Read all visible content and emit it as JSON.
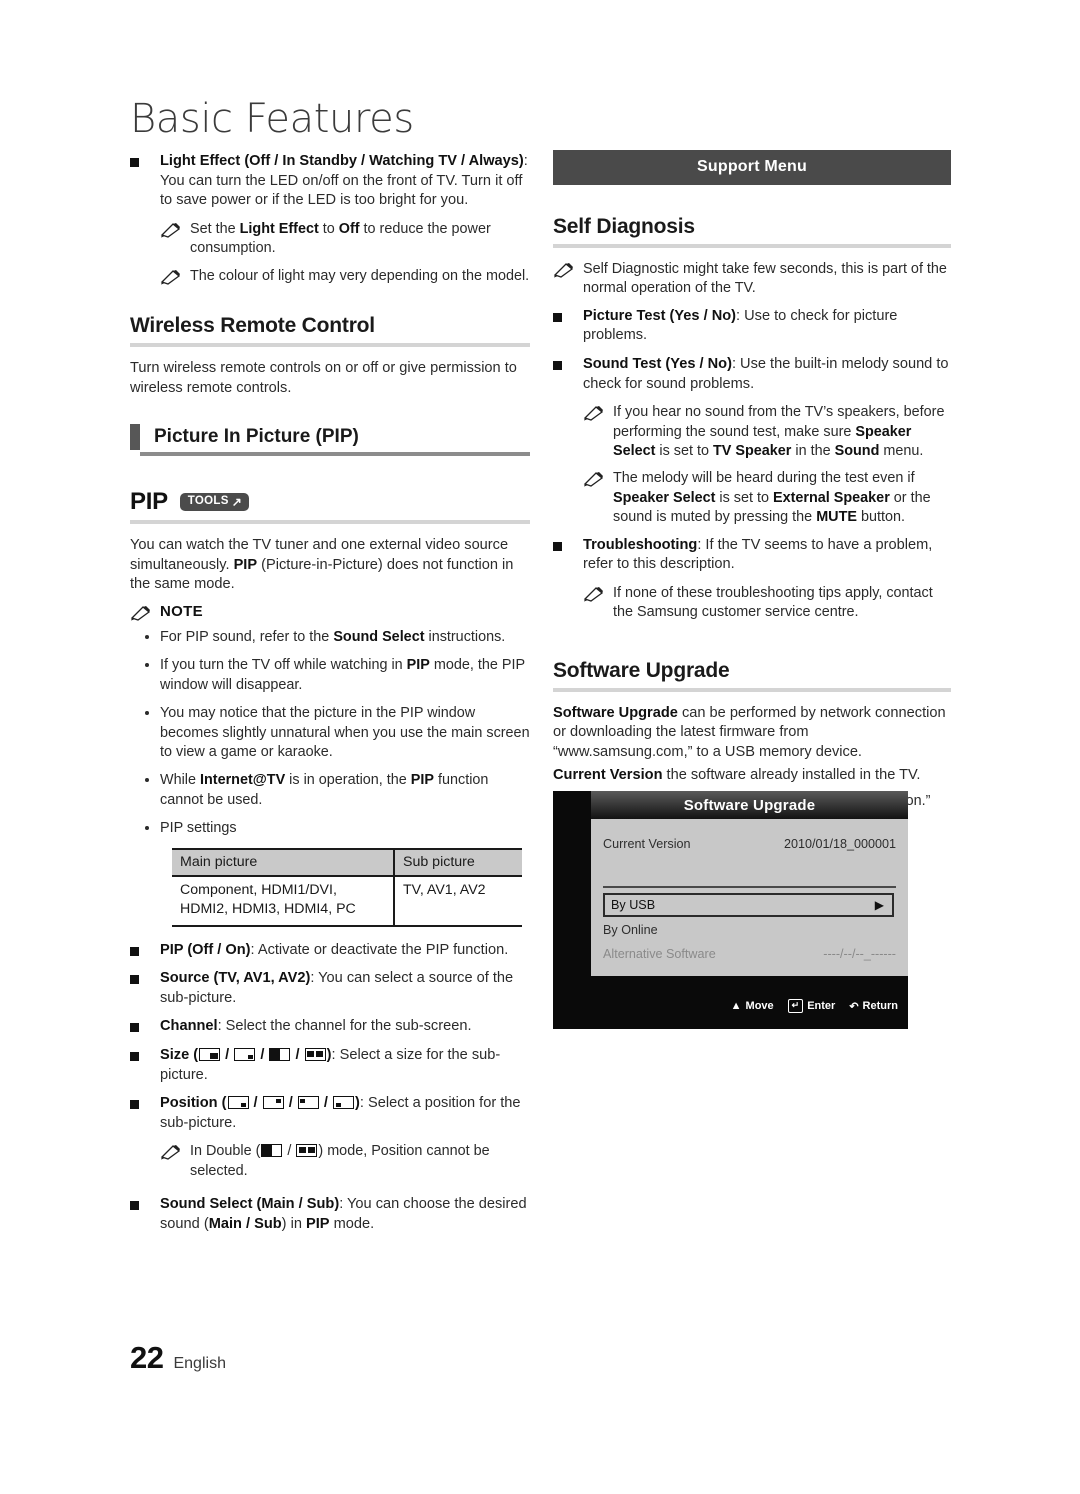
{
  "page": {
    "chapter_title": "Basic Features",
    "page_number": "22",
    "language": "English"
  },
  "left_column": {
    "light_effect": {
      "bullet": {
        "bold": "Light Effect (Off / In Standby / Watching TV / Always)",
        "rest": ": You can turn the LED on/off on the front of TV. Turn it off to save power or if the LED is too bright for you."
      },
      "notes": [
        "Set the Light Effect to Off to reduce the power consumption.",
        "The colour of light may very depending on the model."
      ]
    },
    "wireless_remote_control": {
      "heading": "Wireless Remote Control",
      "body": "Turn wireless remote controls on or off or give permission to wireless remote controls."
    },
    "pip_section": {
      "subheading": "Picture In Picture (PIP)",
      "pip_word": "PIP",
      "tools_badge": "TOOLS",
      "body": "You can watch the TV tuner and one external video source simultaneously. PIP (Picture-in-Picture) does not function in the same mode.",
      "note_label": "NOTE",
      "notes": [
        "For PIP sound, refer to the Sound Select instructions.",
        "If you turn the TV off while watching in PIP mode, the PIP window will disappear.",
        "You may notice that the picture in the PIP window becomes slightly unnatural when you use the main screen to view a game or karaoke.",
        "While Internet@TV is in operation, the PIP function cannot be used.",
        "PIP settings"
      ],
      "table": {
        "headers": [
          "Main picture",
          "Sub picture"
        ],
        "rows": [
          [
            "Component, HDMI1/DVI, HDMI2, HDMI3, HDMI4, PC",
            "TV, AV1, AV2"
          ]
        ]
      },
      "settings": [
        {
          "bold": "PIP (Off / On)",
          "rest": ": Activate or deactivate the PIP function."
        },
        {
          "bold": "Source (TV, AV1, AV2)",
          "rest": ": You can select a source of the sub-picture."
        },
        {
          "bold": "Channel",
          "rest": ": Select the channel for the sub-screen."
        }
      ],
      "size_item": {
        "bold": "Size",
        "rest": ": Select a size for the sub-picture.",
        "icons": [
          "size-large-pip-icon",
          "size-small-pip-icon",
          "size-double-wide-icon",
          "size-double-window-icon"
        ]
      },
      "position_item": {
        "bold": "Position",
        "rest": ": Select a position for the sub-picture.",
        "icons": [
          "position-bottom-right-icon",
          "position-top-right-icon",
          "position-top-left-icon",
          "position-bottom-left-icon"
        ]
      },
      "double_note": {
        "pre": "In Double (",
        "post": ") mode, Position cannot be selected."
      },
      "sound_select": {
        "bold": "Sound Select (Main / Sub)",
        "rest": ": You can choose the desired sound (Main / Sub) in PIP mode."
      }
    }
  },
  "right_column": {
    "banner": "Support Menu",
    "self_diagnosis": {
      "heading": "Self Diagnosis",
      "note_top": "Self Diagnostic might take few seconds, this is part of the normal operation of the TV.",
      "picture_test": {
        "bold": "Picture Test (Yes / No)",
        "rest": ": Use to check for picture problems."
      },
      "sound_test": {
        "bold": "Sound Test (Yes / No)",
        "rest": ": Use the built-in melody sound to check for sound problems."
      },
      "sound_notes": [
        "If you hear no sound from the TV's speakers, before performing the sound test, make sure Speaker Select is set to TV Speaker in the Sound menu.",
        "The melody will be heard during the test even if Speaker Select is set to External Speaker or the sound is muted by pressing the MUTE button."
      ],
      "troubleshooting": {
        "bold": "Troubleshooting",
        "rest": ": If the TV seems to have a problem, refer to this description."
      },
      "troubleshooting_note": "If none of these troubleshooting tips apply, contact the Samsung customer service centre."
    },
    "software_upgrade": {
      "heading": "Software Upgrade",
      "body1_bold": "Software Upgrade",
      "body1_rest": " can be performed by network connection or downloading the latest firmware from “www.samsung.com,” to a USB memory device.",
      "body2_bold": "Current Version",
      "body2_rest": " the software already installed in the TV.",
      "note": "Software is represented as “Year/Month/Day_Version.”"
    }
  },
  "osd": {
    "title": "Software Upgrade",
    "current_version_label": "Current Version",
    "current_version_value": "2010/01/18_000001",
    "selected_item": "By USB",
    "selected_arrow": "▶",
    "items": [
      {
        "label": "By Online",
        "value": ""
      },
      {
        "label": "Alternative Software",
        "value": "----/--/--_------"
      }
    ],
    "footer": [
      {
        "icon": "↕",
        "label": "Move"
      },
      {
        "icon": "↵",
        "label": "Enter"
      },
      {
        "icon": "↶",
        "label": "Return"
      }
    ]
  },
  "colors": {
    "banner_bg": "#4a4a4a",
    "osd_body": "#c8c8c8",
    "osd_frame": "#0a0a0a",
    "rule": "#d4d4d4",
    "table_header": "#c9c9c9"
  }
}
